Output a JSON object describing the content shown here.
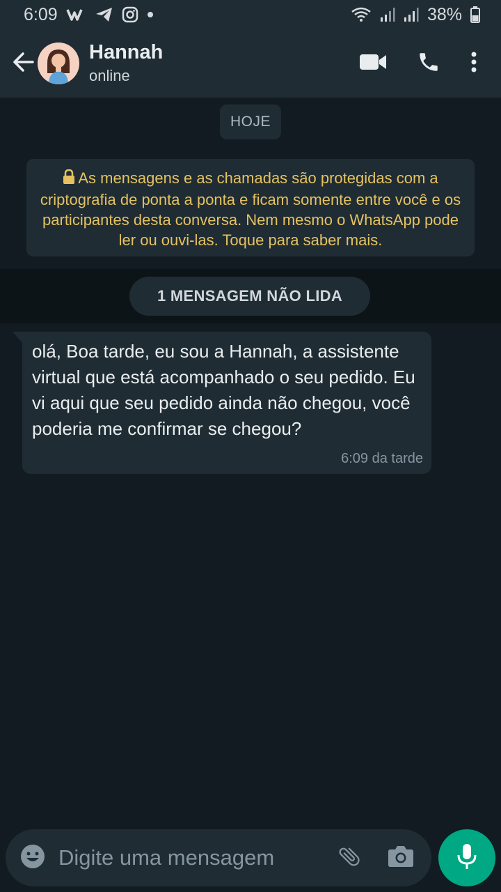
{
  "status_bar": {
    "time": "6:09",
    "battery": "38%",
    "icons": [
      "wattpad-icon",
      "telegram-icon",
      "instagram-icon",
      "dot-icon",
      "wifi-icon",
      "signal-icon",
      "signal-icon",
      "battery-icon"
    ]
  },
  "header": {
    "contact_name": "Hannah",
    "contact_status": "online",
    "icons": [
      "back-arrow-icon",
      "video-call-icon",
      "voice-call-icon",
      "more-options-icon"
    ]
  },
  "chat": {
    "date_label": "HOJE",
    "encryption_notice": "As mensagens e as chamadas são protegidas com a criptografia de ponta a ponta e ficam somente entre você e os participantes desta conversa. Nem mesmo o WhatsApp pode ler ou ouvi-las. Toque para saber mais.",
    "unread_label": "1 MENSAGEM NÃO LIDA",
    "messages": [
      {
        "direction": "incoming",
        "text": "olá,  Boa tarde,  eu sou a Hannah, a assistente virtual que está acompanhado o seu pedido.  Eu vi aqui que seu pedido ainda não chegou,  você poderia me confirmar se chegou?",
        "time": "6:09 da tarde"
      }
    ]
  },
  "composer": {
    "placeholder": "Digite uma mensagem",
    "value": "",
    "icons": [
      "emoji-icon",
      "attach-icon",
      "camera-icon",
      "mic-icon"
    ]
  },
  "colors": {
    "background": "#121b22",
    "bar": "#1f2c34",
    "accent": "#00a884",
    "encryption_text": "#e5c25f"
  }
}
